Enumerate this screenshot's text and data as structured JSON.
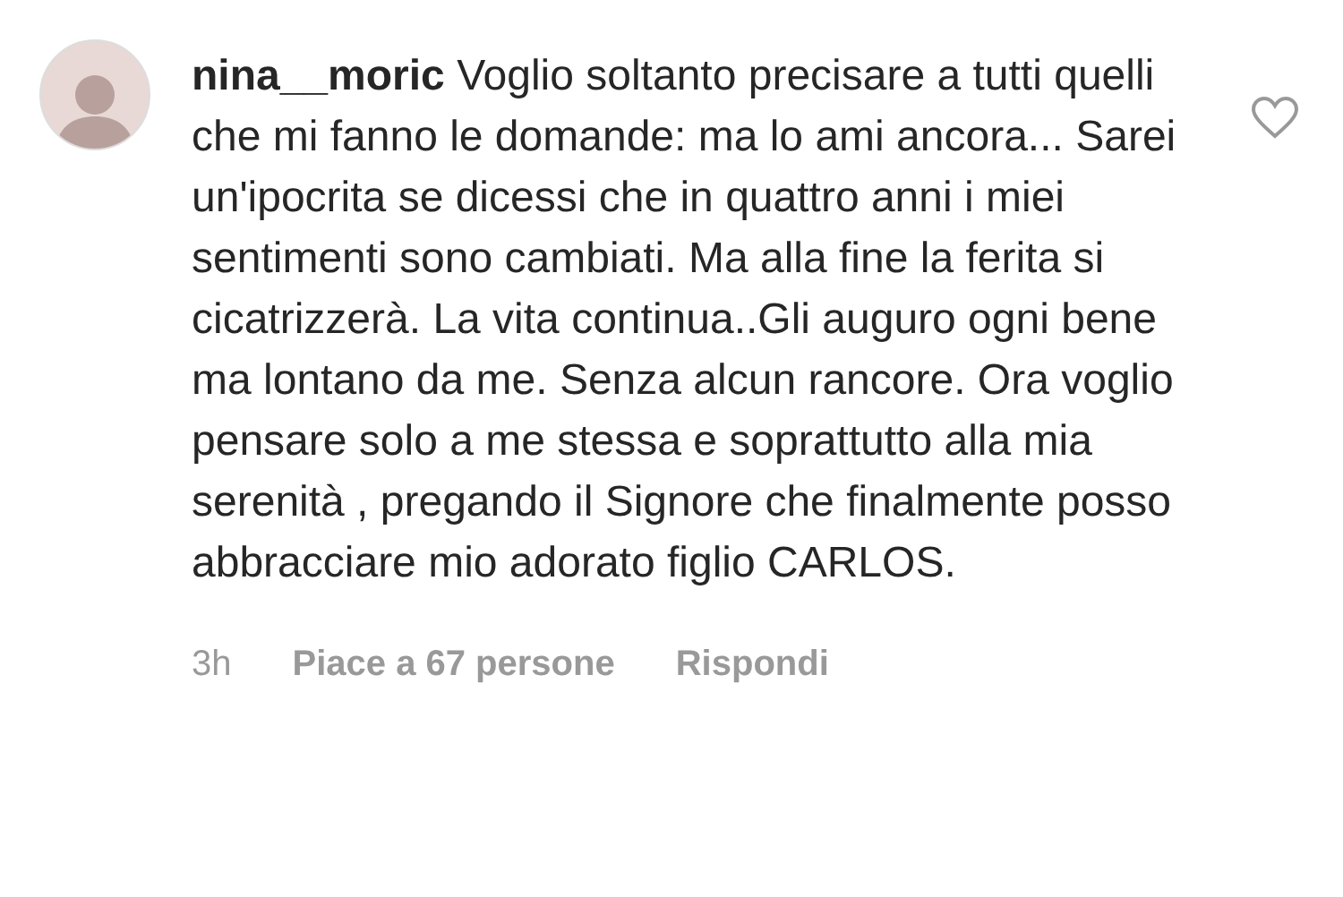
{
  "comment": {
    "username": "nina__moric",
    "text": "Voglio soltanto precisare a tutti quelli che mi fanno le domande: ma lo ami ancora... Sarei un'ipocrita se dicessi che in quattro anni i miei sentimenti sono cambiati. Ma alla fine la ferita si cicatrizzerà. La vita continua..Gli auguro ogni bene ma lontano da me. Senza alcun rancore. Ora voglio pensare solo a me stessa e soprattutto alla mia serenità , pregando il Signore che finalmente posso abbracciare mio adorato figlio CARLOS.",
    "liked": false,
    "time": "3h",
    "likes": "Piace a 67 persone",
    "reply": "Rispondi"
  }
}
